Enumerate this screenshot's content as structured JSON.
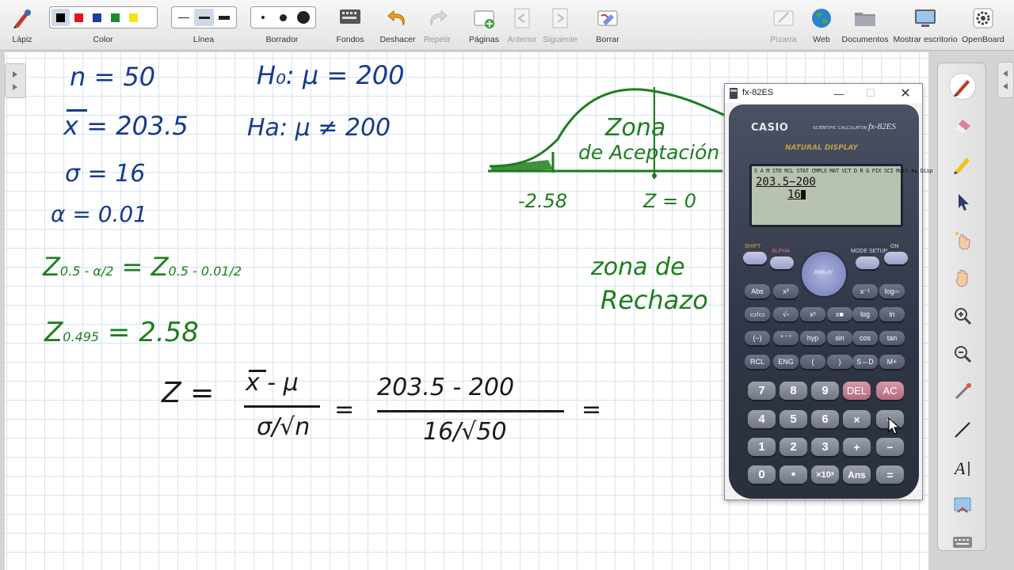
{
  "toolbar": {
    "pen_label": "Lápiz",
    "color_label": "Color",
    "line_label": "Línea",
    "eraser_label": "Borrador",
    "backgrounds_label": "Fondos",
    "undo_label": "Deshacer",
    "redo_label": "Repetir",
    "pages_label": "Páginas",
    "previous_label": "Anterior",
    "next_label": "Siguiente",
    "erase_label": "Borrar",
    "board_label": "Pizarra",
    "web_label": "Web",
    "documents_label": "Documentos",
    "desktop_label": "Mostrar escritorio",
    "openboard_label": "OpenBoard",
    "colors": [
      "#000000",
      "#e8141b",
      "#1b3f9c",
      "#1e8c2e",
      "#f6e215"
    ]
  },
  "board": {
    "n": "n = 50",
    "xbar": "x = 203.5",
    "sigma": "σ = 16",
    "alpha": "α = 0.01",
    "h0": "H₀: μ = 200",
    "ha": "Ha: μ ≠ 200",
    "z_formula_left": "Z",
    "z_formula_sub": "0.5 - α/2",
    "z_formula_right": "= Z",
    "z_formula_right_sub": "0.5 - 0.01/2",
    "z_value_label": "Z",
    "z_value_sub": "0.495",
    "z_value": "= 2.58",
    "zona_aceptacion_1": "Zona",
    "zona_aceptacion_2": "de Aceptación",
    "zona_rechazo_1": "zona de",
    "zona_rechazo_2": "Rechazo",
    "neg_crit": "-2.58",
    "z_zero": "Z = 0",
    "formula_z": "Z =",
    "formula_num": "x - μ",
    "formula_den": "σ/√n",
    "eq1": "=",
    "calc_num": "203.5 - 200",
    "calc_den": "16/√50",
    "eq2": "="
  },
  "calculator": {
    "window_title": "fx-82ES",
    "brand": "CASIO",
    "model_line": "SCIENTIFIC CALCULATOR",
    "model": "fx-82ES",
    "natural_display": "NATURAL DISPLAY",
    "indicators": "S A M STO RCL STAT CMPLX MAT VCT D R G FIX SCI Math ▼▲ Disp",
    "line1": "203.5−200",
    "line2": "16",
    "keys": {
      "shift": "SHIFT",
      "alpha": "ALPHA",
      "mode": "MODE SETUP",
      "on": "ON",
      "replay": "REPLAY",
      "abs": "Abs",
      "x3": "x³",
      "xinv": "x⁻¹",
      "logab": "log▫▫",
      "frac": "▭/▭",
      "sqrt": "√▫",
      "x2": "x²",
      "xpow": "x■",
      "log": "log",
      "ln": "ln",
      "neg": "(−)",
      "dms": "° ' ''",
      "hyp": "hyp",
      "sin": "sin",
      "cos": "cos",
      "tan": "tan",
      "rcl": "RCL",
      "eng": "ENG",
      "lpar": "(",
      "rpar": ")",
      "sd": "S⇔D",
      "mplus": "M+",
      "k7": "7",
      "k8": "8",
      "k9": "9",
      "del": "DEL",
      "ac": "AC",
      "k4": "4",
      "k5": "5",
      "k6": "6",
      "mul": "×",
      "div": "÷",
      "k1": "1",
      "k2": "2",
      "k3": "3",
      "add": "+",
      "sub": "−",
      "k0": "0",
      "dot": "•",
      "exp": "×10ˣ",
      "ans": "Ans",
      "eq": "="
    }
  }
}
